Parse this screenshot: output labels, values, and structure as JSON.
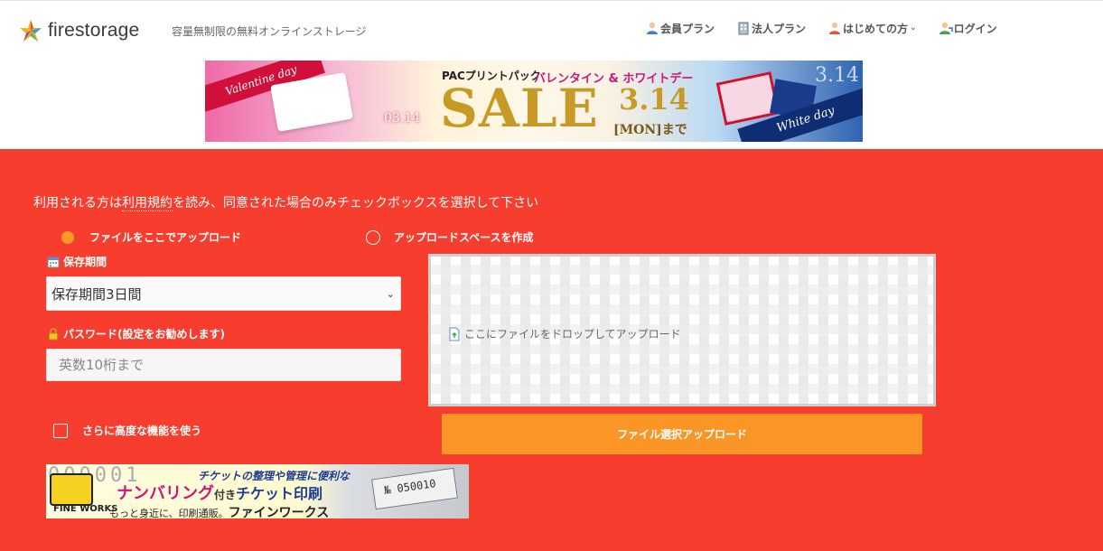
{
  "header": {
    "logo_text": "firestorage",
    "tagline": "容量無制限の無料オンラインストレージ",
    "nav": [
      {
        "label": "会員プラン",
        "icon": "member-icon"
      },
      {
        "label": "法人プラン",
        "icon": "building-icon"
      },
      {
        "label": "はじめての方",
        "icon": "beginner-icon",
        "dropdown": true
      },
      {
        "label": "ログイン",
        "icon": "login-icon"
      }
    ]
  },
  "banner": {
    "ribbon_left": "Valentine day",
    "ribbon_right": "White day",
    "date_small": "03.14",
    "brand": "PACプリントパック",
    "headline": "バレンタイン & ホワイトデー",
    "sale": "SALE",
    "date": "3.14",
    "until": "[MON]まで",
    "date_right": "3.14"
  },
  "form": {
    "notice_prefix": "利用される方は",
    "notice_link": "利用規約",
    "notice_suffix": "を読み、同意された場合のみチェックボックスを選択して下さい",
    "option_upload": "ファイルをここでアップロード",
    "option_space": "アップロードスペースを作成",
    "period_label": "保存期間",
    "period_value": "保存期間3日間",
    "password_label": "パスワード(設定をお勧めします)",
    "password_placeholder": "英数10桁まで",
    "advanced_label": "さらに高度な機能を使う",
    "drop_text": "ここにファイルをドロップしてアップロード",
    "upload_button": "ファイル選択アップロード"
  },
  "ad": {
    "numbers": "000001",
    "line1": "チケットの整理や管理に便利な",
    "headline": "ナンバリング",
    "sub": "付き",
    "headline2": "チケット印刷",
    "brand": "FINE WORKS",
    "tagline": "もっと身近に、印刷通販。",
    "tagline_brand": "ファインワークス",
    "ticket_number": "№ 050010"
  },
  "colors": {
    "main_bg": "#f73d2d",
    "accent": "#fb9526"
  }
}
